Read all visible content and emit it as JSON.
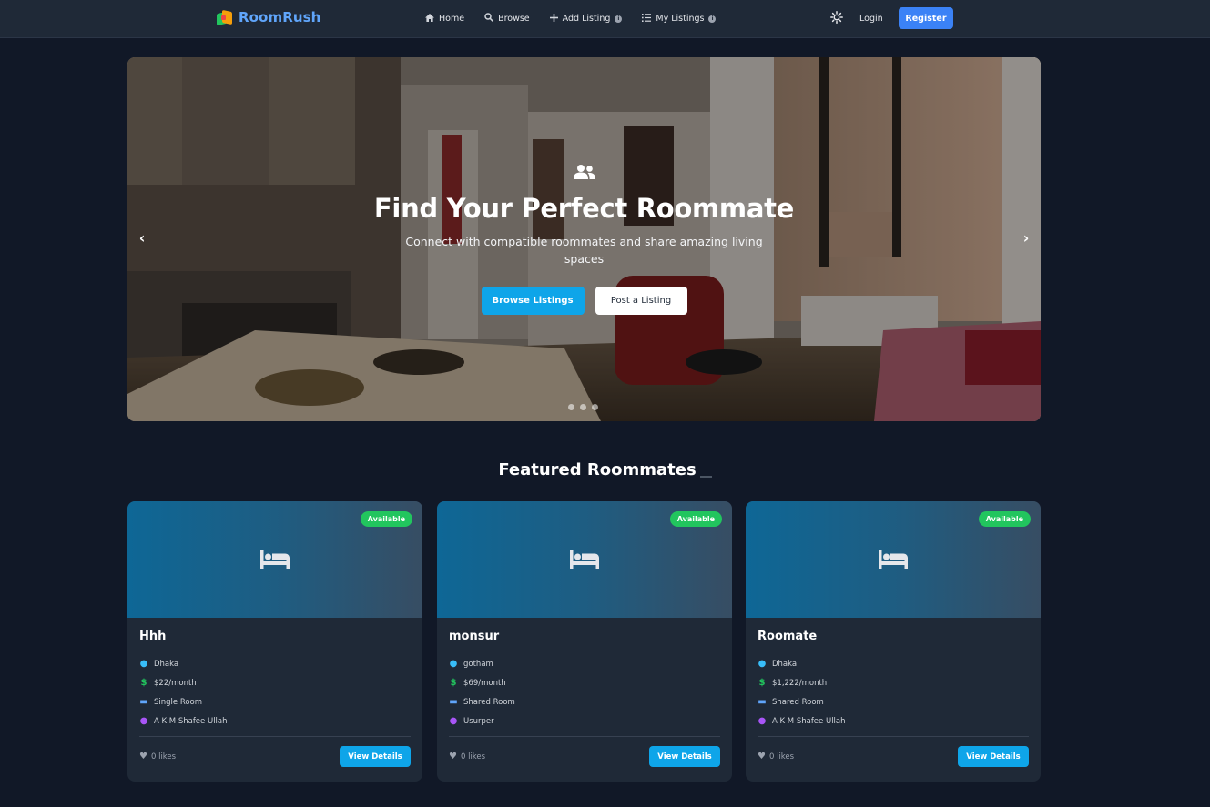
{
  "brand": {
    "name": "RoomRush"
  },
  "nav": {
    "home": "Home",
    "browse": "Browse",
    "add_listing": "Add Listing",
    "my_listings": "My Listings",
    "login": "Login",
    "register": "Register"
  },
  "hero": {
    "title": "Find Your Perfect Roommate",
    "subtitle": "Connect with compatible roommates and share amazing living spaces",
    "browse_button": "Browse Listings",
    "post_button": "Post a Listing",
    "prev": "‹",
    "next": "›",
    "slide_count": 3
  },
  "featured": {
    "title": "Featured Roommates",
    "cards": [
      {
        "badge": "Available",
        "title": "Hhh",
        "location": "Dhaka",
        "rent": "$22/month",
        "room_type": "Single Room",
        "owner": "A K M Shafee Ullah",
        "likes": "0 likes",
        "button": "View Details"
      },
      {
        "badge": "Available",
        "title": "monsur",
        "location": "gotham",
        "rent": "$69/month",
        "room_type": "Shared Room",
        "owner": "Usurper",
        "likes": "0 likes",
        "button": "View Details"
      },
      {
        "badge": "Available",
        "title": "Roomate",
        "location": "Dhaka",
        "rent": "$1,222/month",
        "room_type": "Shared Room",
        "owner": "A K M Shafee Ullah",
        "likes": "0 likes",
        "button": "View Details"
      }
    ]
  },
  "colors": {
    "background": "#111827",
    "navbar": "#1f2937",
    "brand": "#60a5fa",
    "primary": "#0ea5e9",
    "register": "#3b82f6",
    "available": "#22c55e"
  },
  "icons": {
    "home": "home-icon",
    "browse": "search-icon",
    "add": "plus-icon",
    "list": "list-icon",
    "theme": "sun-icon",
    "hero": "users-icon",
    "card_image": "bed-icon",
    "location": "map-pin-icon",
    "rent": "dollar-icon",
    "room_type": "bed-icon",
    "owner": "user-icon",
    "likes": "heart-icon"
  }
}
